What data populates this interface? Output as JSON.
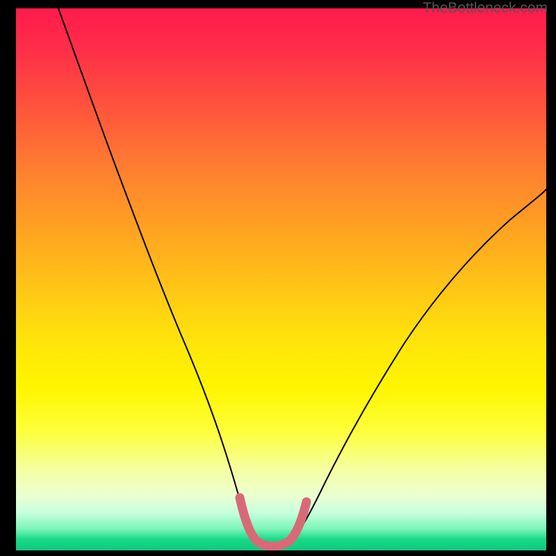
{
  "watermark": "TheBottleneck.com",
  "chart_data": {
    "type": "line",
    "title": "",
    "xlabel": "",
    "ylabel": "",
    "xlim": [
      0,
      100
    ],
    "ylim": [
      0,
      100
    ],
    "background_gradient": {
      "top": "#ff1a4d",
      "middle": "#ffe60a",
      "bottom": "#10c97c"
    },
    "series": [
      {
        "name": "bottleneck-curve",
        "color": "#000000",
        "stroke_width": 2,
        "x": [
          8,
          12,
          16,
          20,
          24,
          28,
          32,
          36,
          40,
          42,
          44,
          45,
          46,
          47,
          48,
          50,
          52,
          54,
          58,
          62,
          68,
          74,
          80,
          86,
          92,
          98,
          100
        ],
        "y": [
          100,
          90,
          79,
          68,
          57,
          46,
          35,
          25,
          15,
          10,
          6,
          4,
          2.5,
          2,
          2,
          2,
          2.5,
          4,
          8,
          13,
          21,
          29,
          36,
          43,
          49,
          55,
          57
        ]
      },
      {
        "name": "optimal-marker",
        "color": "#d86a78",
        "stroke_width": 12,
        "linecap": "round",
        "x": [
          42.5,
          44,
          45,
          46,
          48,
          50,
          52,
          53,
          54.5
        ],
        "y": [
          9,
          5,
          3,
          2.3,
          2,
          2,
          2.3,
          3.5,
          7
        ]
      }
    ]
  }
}
